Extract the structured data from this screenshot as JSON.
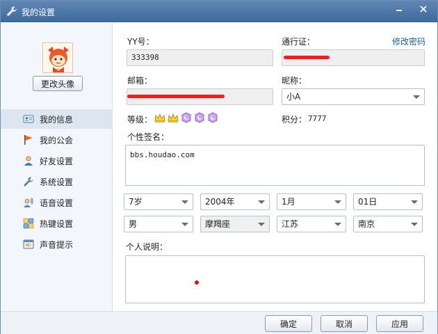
{
  "window": {
    "title": "我的设置"
  },
  "sidebar": {
    "avatar_button": "更改头像",
    "items": [
      {
        "label": "我的信息",
        "icon": "id-card-icon"
      },
      {
        "label": "我的公会",
        "icon": "flag-icon"
      },
      {
        "label": "好友设置",
        "icon": "user-icon"
      },
      {
        "label": "系统设置",
        "icon": "wrench-icon"
      },
      {
        "label": "语音设置",
        "icon": "voice-icon"
      },
      {
        "label": "热键设置",
        "icon": "hotkey-icon"
      },
      {
        "label": "声音提示",
        "icon": "sound-alert-icon"
      }
    ]
  },
  "form": {
    "yy_label": "YY号：",
    "yy_value": "333398",
    "passport_label": "通行证：",
    "change_password": "修改密码",
    "email_label": "邮箱：",
    "nickname_label": "昵称：",
    "nickname_value": "小A",
    "level_label": "等级：",
    "points_label": "积分：",
    "points_value": "7777",
    "signature_label": "个性签名：",
    "signature_value": "bbs.houdao.com",
    "age": "7岁",
    "year": "2004年",
    "month": "1月",
    "day": "01日",
    "gender": "男",
    "zodiac": "摩羯座",
    "province": "江苏",
    "city": "南京",
    "description_label": "个人说明："
  },
  "footer": {
    "ok": "确定",
    "cancel": "取消",
    "apply": "应用"
  },
  "colors": {
    "title_bar": "#4a77a8",
    "link": "#1a5fa8",
    "redaction": "#ff1a1a"
  }
}
